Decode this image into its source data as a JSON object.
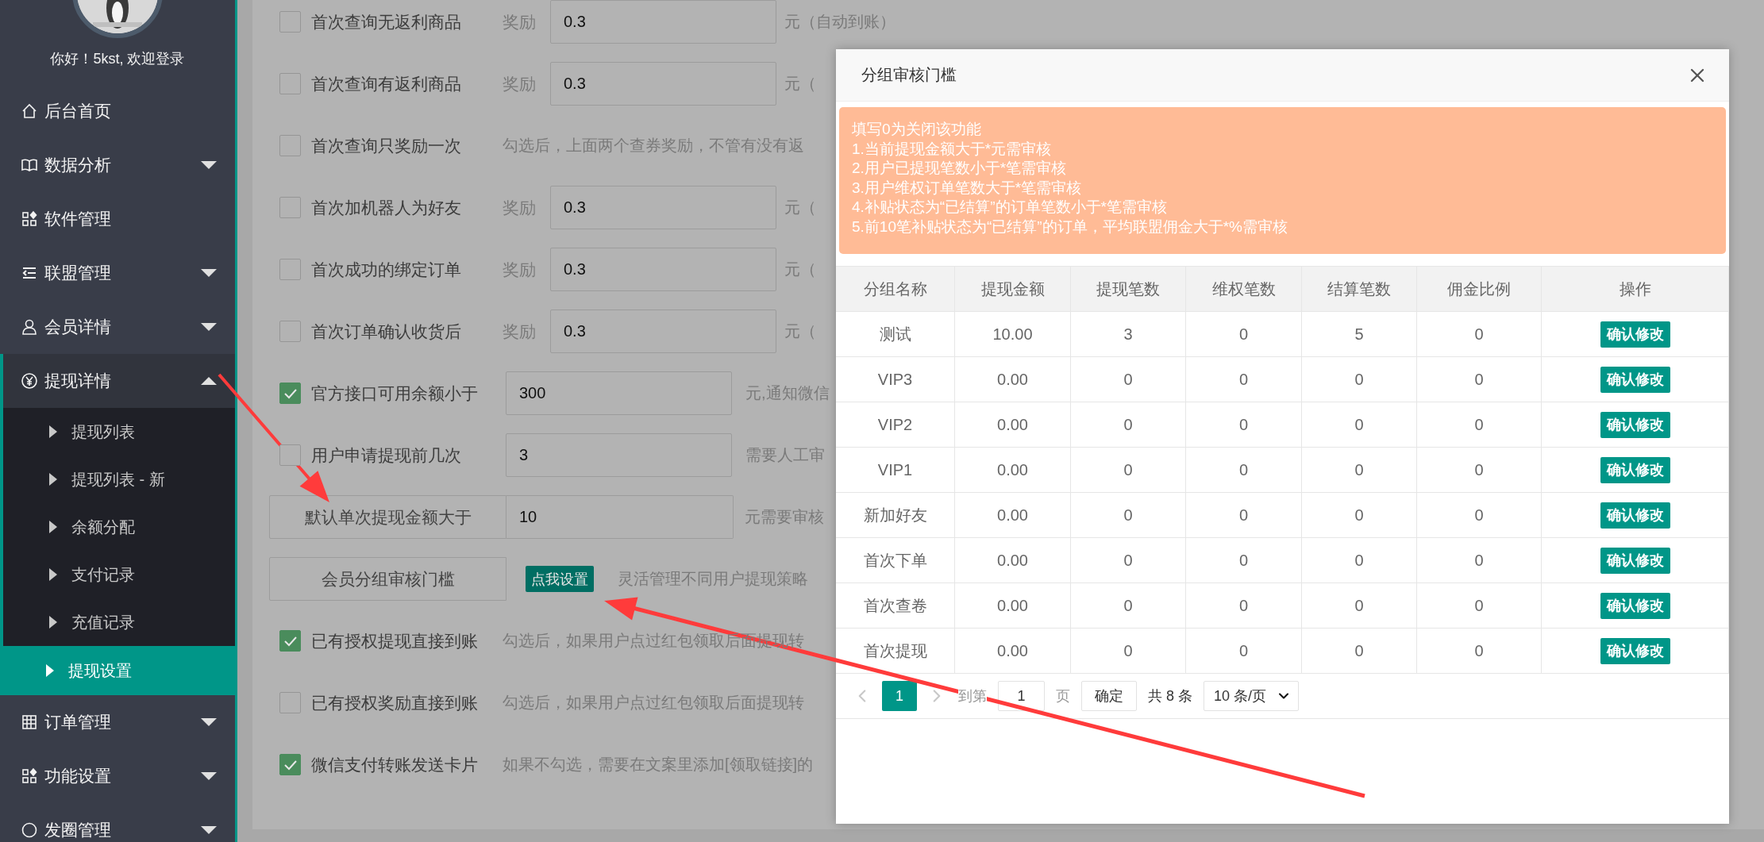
{
  "sidebar": {
    "greeting": "你好！5kst, 欢迎登录",
    "menu": [
      {
        "label": "后台首页",
        "kind": "link"
      },
      {
        "label": "数据分析",
        "kind": "group",
        "expanded": false
      },
      {
        "label": "软件管理",
        "kind": "link"
      },
      {
        "label": "联盟管理",
        "kind": "group",
        "expanded": false
      },
      {
        "label": "会员详情",
        "kind": "group",
        "expanded": false
      },
      {
        "label": "提现详情",
        "kind": "group",
        "expanded": true,
        "children": [
          {
            "label": "提现列表",
            "selected": false
          },
          {
            "label": "提现列表 - 新",
            "selected": false
          },
          {
            "label": "余额分配",
            "selected": false
          },
          {
            "label": "支付记录",
            "selected": false
          },
          {
            "label": "充值记录",
            "selected": false
          },
          {
            "label": "提现设置",
            "selected": true
          }
        ]
      },
      {
        "label": "订单管理",
        "kind": "group",
        "expanded": false
      },
      {
        "label": "功能设置",
        "kind": "group",
        "expanded": false
      },
      {
        "label": "发圈管理",
        "kind": "group",
        "expanded": false
      }
    ]
  },
  "form": {
    "rows": [
      {
        "kind": "reward",
        "checked": false,
        "label": "首次查询无返利商品",
        "hint": "奖励",
        "value": "0.3",
        "suffix": "元（自动到账）"
      },
      {
        "kind": "reward",
        "checked": false,
        "label": "首次查询有返利商品",
        "hint": "奖励",
        "value": "0.3",
        "suffix": "元（"
      },
      {
        "kind": "note",
        "checked": false,
        "label": "首次查询只奖励一次",
        "note": "勾选后，上面两个查券奖励，不管有没有返"
      },
      {
        "kind": "reward",
        "checked": false,
        "label": "首次加机器人为好友",
        "hint": "奖励",
        "value": "0.3",
        "suffix": "元（"
      },
      {
        "kind": "reward",
        "checked": false,
        "label": "首次成功的绑定订单",
        "hint": "奖励",
        "value": "0.3",
        "suffix": "元（"
      },
      {
        "kind": "reward",
        "checked": false,
        "label": "首次订单确认收货后",
        "hint": "奖励",
        "value": "0.3",
        "suffix": "元（"
      },
      {
        "kind": "threshold",
        "checked": true,
        "label": "官方接口可用余额小于",
        "value": "300",
        "suffix": "元,通知微信"
      },
      {
        "kind": "threshold",
        "checked": false,
        "label": "用户申请提现前几次",
        "value": "3",
        "suffix": "需要人工审"
      },
      {
        "kind": "addon",
        "label": "默认单次提现金额大于",
        "value": "10",
        "suffix": "元需要审核"
      },
      {
        "kind": "action",
        "label": "会员分组审核门槛",
        "button": "点我设置",
        "note": "灵活管理不同用户提现策略"
      },
      {
        "kind": "note",
        "checked": true,
        "label": "已有授权提现直接到账",
        "note": "勾选后，如果用户点过红包领取后面提现转"
      },
      {
        "kind": "note",
        "checked": false,
        "label": "已有授权奖励直接到账",
        "note": "勾选后，如果用户点过红包领取后面提现转"
      },
      {
        "kind": "note",
        "checked": true,
        "label": "微信支付转账发送卡片",
        "note": "如果不勾选，需要在文案里添加[领取链接]的"
      }
    ]
  },
  "modal": {
    "title": "分组审核门槛",
    "notice": [
      "填写0为关闭该功能",
      "1.当前提现金额大于*元需审核",
      "2.用户已提现笔数小于*笔需审核",
      "3.用户维权订单笔数大于*笔需审核",
      "4.补贴状态为“已结算”的订单笔数小于*笔需审核",
      "5.前10笔补贴状态为“已结算”的订单，平均联盟佣金大于*%需审核"
    ],
    "table": {
      "columns": [
        "分组名称",
        "提现金额",
        "提现笔数",
        "维权笔数",
        "结算笔数",
        "佣金比例",
        "操作"
      ],
      "rows": [
        {
          "cells": [
            "测试",
            "10.00",
            "3",
            "0",
            "5",
            "0"
          ],
          "action": "确认修改"
        },
        {
          "cells": [
            "VIP3",
            "0.00",
            "0",
            "0",
            "0",
            "0"
          ],
          "action": "确认修改"
        },
        {
          "cells": [
            "VIP2",
            "0.00",
            "0",
            "0",
            "0",
            "0"
          ],
          "action": "确认修改"
        },
        {
          "cells": [
            "VIP1",
            "0.00",
            "0",
            "0",
            "0",
            "0"
          ],
          "action": "确认修改"
        },
        {
          "cells": [
            "新加好友",
            "0.00",
            "0",
            "0",
            "0",
            "0"
          ],
          "action": "确认修改"
        },
        {
          "cells": [
            "首次下单",
            "0.00",
            "0",
            "0",
            "0",
            "0"
          ],
          "action": "确认修改"
        },
        {
          "cells": [
            "首次查卷",
            "0.00",
            "0",
            "0",
            "0",
            "0"
          ],
          "action": "确认修改"
        },
        {
          "cells": [
            "首次提现",
            "0.00",
            "0",
            "0",
            "0",
            "0"
          ],
          "action": "确认修改"
        }
      ]
    },
    "pagination": {
      "pages": [
        {
          "label": "1",
          "selected": true
        }
      ],
      "goto_label": "到第",
      "goto_value": "1",
      "page_unit": "页",
      "confirm": "确定",
      "total": "共 8 条",
      "page_size": "10 条/页"
    }
  }
}
